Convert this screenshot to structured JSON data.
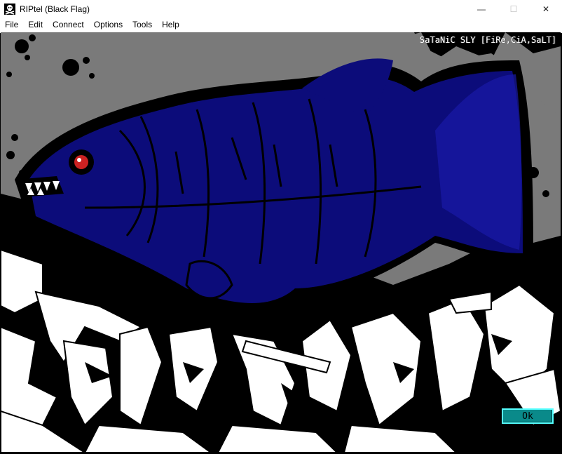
{
  "window": {
    "title": "RIPtel (Black Flag)",
    "icon": "jolly-roger-icon",
    "controls": {
      "minimize": "—",
      "maximize": "☐",
      "close": "✕"
    }
  },
  "menu": {
    "items": [
      {
        "label": "File"
      },
      {
        "label": "Edit"
      },
      {
        "label": "Connect"
      },
      {
        "label": "Options"
      },
      {
        "label": "Tools"
      },
      {
        "label": "Help"
      }
    ]
  },
  "artwork": {
    "credit": "SaTaNiC SLY [FiRe,CiA,SaLT]",
    "subject": "piranha",
    "colors": {
      "background": "#000000",
      "splatter": "#7a7a7a",
      "fish_body": "#0c0c7a",
      "fish_light": "#1a1aa8",
      "eye": "#cc2222",
      "graffiti": "#ffffff"
    }
  },
  "dialog": {
    "ok_label": "Ok",
    "ok_color": "#0a8a8a"
  }
}
